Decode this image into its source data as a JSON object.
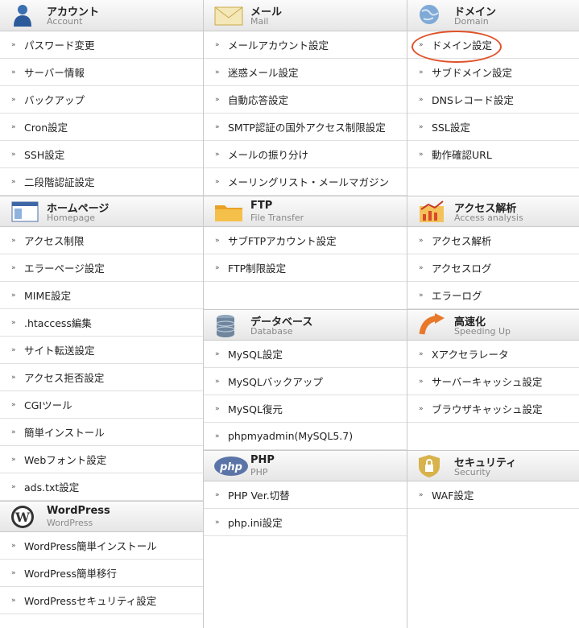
{
  "columns": [
    [
      {
        "key": "account",
        "icon": "user-icon",
        "title": "アカウント",
        "subtitle": "Account",
        "items": [
          "パスワード変更",
          "サーバー情報",
          "バックアップ",
          "Cron設定",
          "SSH設定",
          "二段階認証設定"
        ]
      },
      {
        "key": "homepage",
        "icon": "window-icon",
        "title": "ホームページ",
        "subtitle": "Homepage",
        "items": [
          "アクセス制限",
          "エラーページ設定",
          "MIME設定",
          ".htaccess編集",
          "サイト転送設定",
          "アクセス拒否設定",
          "CGIツール",
          "簡単インストール",
          "Webフォント設定",
          "ads.txt設定"
        ]
      },
      {
        "key": "wordpress",
        "icon": "wordpress-icon",
        "title": "WordPress",
        "subtitle": "WordPress",
        "items": [
          "WordPress簡単インストール",
          "WordPress簡単移行",
          "WordPressセキュリティ設定"
        ]
      }
    ],
    [
      {
        "key": "mail",
        "icon": "envelope-icon",
        "title": "メール",
        "subtitle": "Mail",
        "items": [
          "メールアカウント設定",
          "迷惑メール設定",
          "自動応答設定",
          "SMTP認証の国外アクセス制限設定",
          "メールの振り分け",
          "メーリングリスト・メールマガジン"
        ]
      },
      {
        "key": "ftp",
        "icon": "folder-icon",
        "title": "FTP",
        "subtitle": "File Transfer",
        "items": [
          "サブFTPアカウント設定",
          "FTP制限設定"
        ],
        "empty_rows": 1
      },
      {
        "key": "database",
        "icon": "database-icon",
        "title": "データベース",
        "subtitle": "Database",
        "items": [
          "MySQL設定",
          "MySQLバックアップ",
          "MySQL復元",
          "phpmyadmin(MySQL5.7)"
        ]
      },
      {
        "key": "php",
        "icon": "php-icon",
        "title": "PHP",
        "subtitle": "PHP",
        "items": [
          "PHP Ver.切替",
          "php.ini設定"
        ]
      }
    ],
    [
      {
        "key": "domain",
        "icon": "globe-icon",
        "title": "ドメイン",
        "subtitle": "Domain",
        "items": [
          "ドメイン設定",
          "サブドメイン設定",
          "DNSレコード設定",
          "SSL設定",
          "動作確認URL"
        ],
        "empty_rows": 1
      },
      {
        "key": "access_analysis",
        "icon": "chart-icon",
        "title": "アクセス解析",
        "subtitle": "Access analysis",
        "items": [
          "アクセス解析",
          "アクセスログ",
          "エラーログ"
        ]
      },
      {
        "key": "speedup",
        "icon": "speed-arrow-icon",
        "title": "高速化",
        "subtitle": "Speeding Up",
        "items": [
          "Xアクセラレータ",
          "サーバーキャッシュ設定",
          "ブラウザキャッシュ設定"
        ],
        "empty_rows": 1
      },
      {
        "key": "security",
        "icon": "lock-shield-icon",
        "title": "セキュリティ",
        "subtitle": "Security",
        "items": [
          "WAF設定"
        ]
      }
    ]
  ],
  "highlight": {
    "item": "ドメイン設定",
    "color": "#e0522a"
  }
}
